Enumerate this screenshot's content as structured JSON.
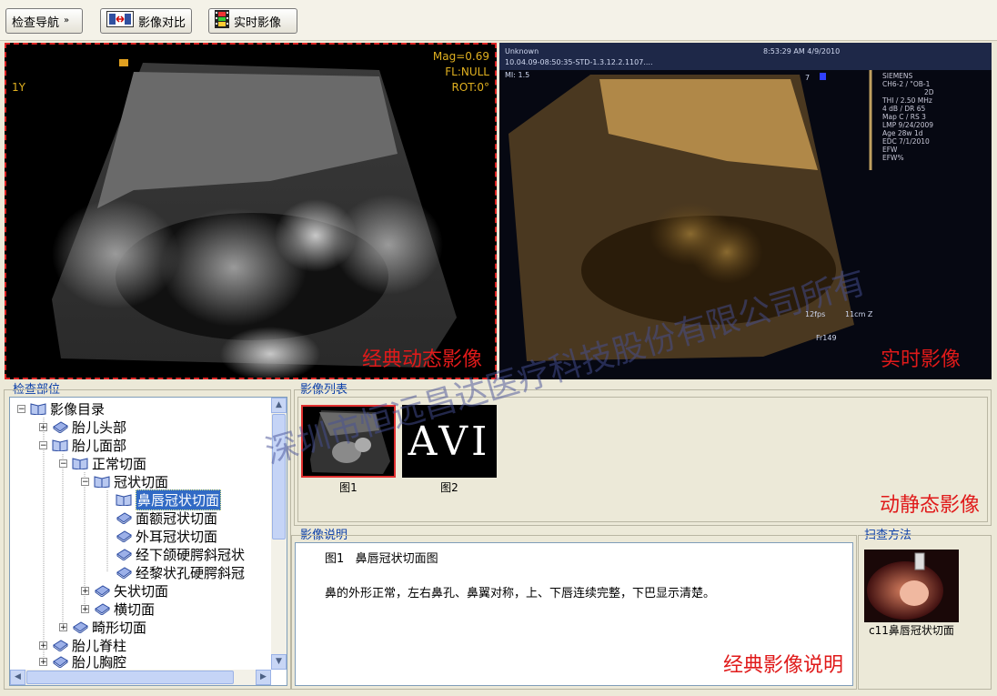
{
  "toolbar": {
    "nav_label": "检查导航",
    "compare_label": "影像对比",
    "live_label": "实时影像"
  },
  "viewer_left": {
    "mag": "Mag=0.69",
    "fl": "FL:NULL",
    "rot": "ROT:0°",
    "tag_1y": "1Y",
    "caption": "经典动态影像"
  },
  "viewer_right": {
    "line1": "Unknown",
    "line2": "10.04.09-08:50:35-STD-1.3.12.2.1107....",
    "line3": "MI: 1.5",
    "time": "8:53:29 AM 4/9/2010",
    "siemens": [
      "SIEMENS",
      "CH6-2 / \"OB-1",
      "2D",
      "THI / 2.50 MHz",
      "4 dB / DR 65",
      "Map C / RS 3",
      "LMP 9/24/2009",
      "Age 28w 1d",
      "EDC 7/1/2010",
      "EFW",
      "EFW%"
    ],
    "fps": "12fps",
    "depth": "11cm Z",
    "frame": "Fr149",
    "marker": "7",
    "caption": "实时影像"
  },
  "watermark": "深圳市恒远昌达医疗科技股份有限公司所有",
  "exam_panel": {
    "title": "检查部位",
    "tree": [
      {
        "label": "影像目录"
      },
      {
        "label": "胎儿头部"
      },
      {
        "label": "胎儿面部"
      },
      {
        "label": "正常切面"
      },
      {
        "label": "冠状切面"
      },
      {
        "label": "鼻唇冠状切面"
      },
      {
        "label": "面额冠状切面"
      },
      {
        "label": "外耳冠状切面"
      },
      {
        "label": "经下颌硬腭斜冠状"
      },
      {
        "label": "经黎状孔硬腭斜冠"
      },
      {
        "label": "矢状切面"
      },
      {
        "label": "横切面"
      },
      {
        "label": "畸形切面"
      },
      {
        "label": "胎儿脊柱"
      },
      {
        "label": "胎儿胸腔"
      }
    ]
  },
  "image_list": {
    "title": "影像列表",
    "items": [
      {
        "label": "图1"
      },
      {
        "label": "图2",
        "thumb_text": "AVI"
      }
    ],
    "caption": "动静态影像"
  },
  "description": {
    "title": "影像说明",
    "heading": "图1   鼻唇冠状切面图",
    "body": "鼻的外形正常，左右鼻孔、鼻翼对称，上、下唇连续完整，下巴显示清楚。",
    "caption": "经典影像说明"
  },
  "scan_method": {
    "title": "扫查方法",
    "label": "c11鼻唇冠状切面"
  },
  "colors": {
    "selection": "#316ac5",
    "caption_red": "#e01a1a",
    "title_blue": "#0a3ea8"
  }
}
